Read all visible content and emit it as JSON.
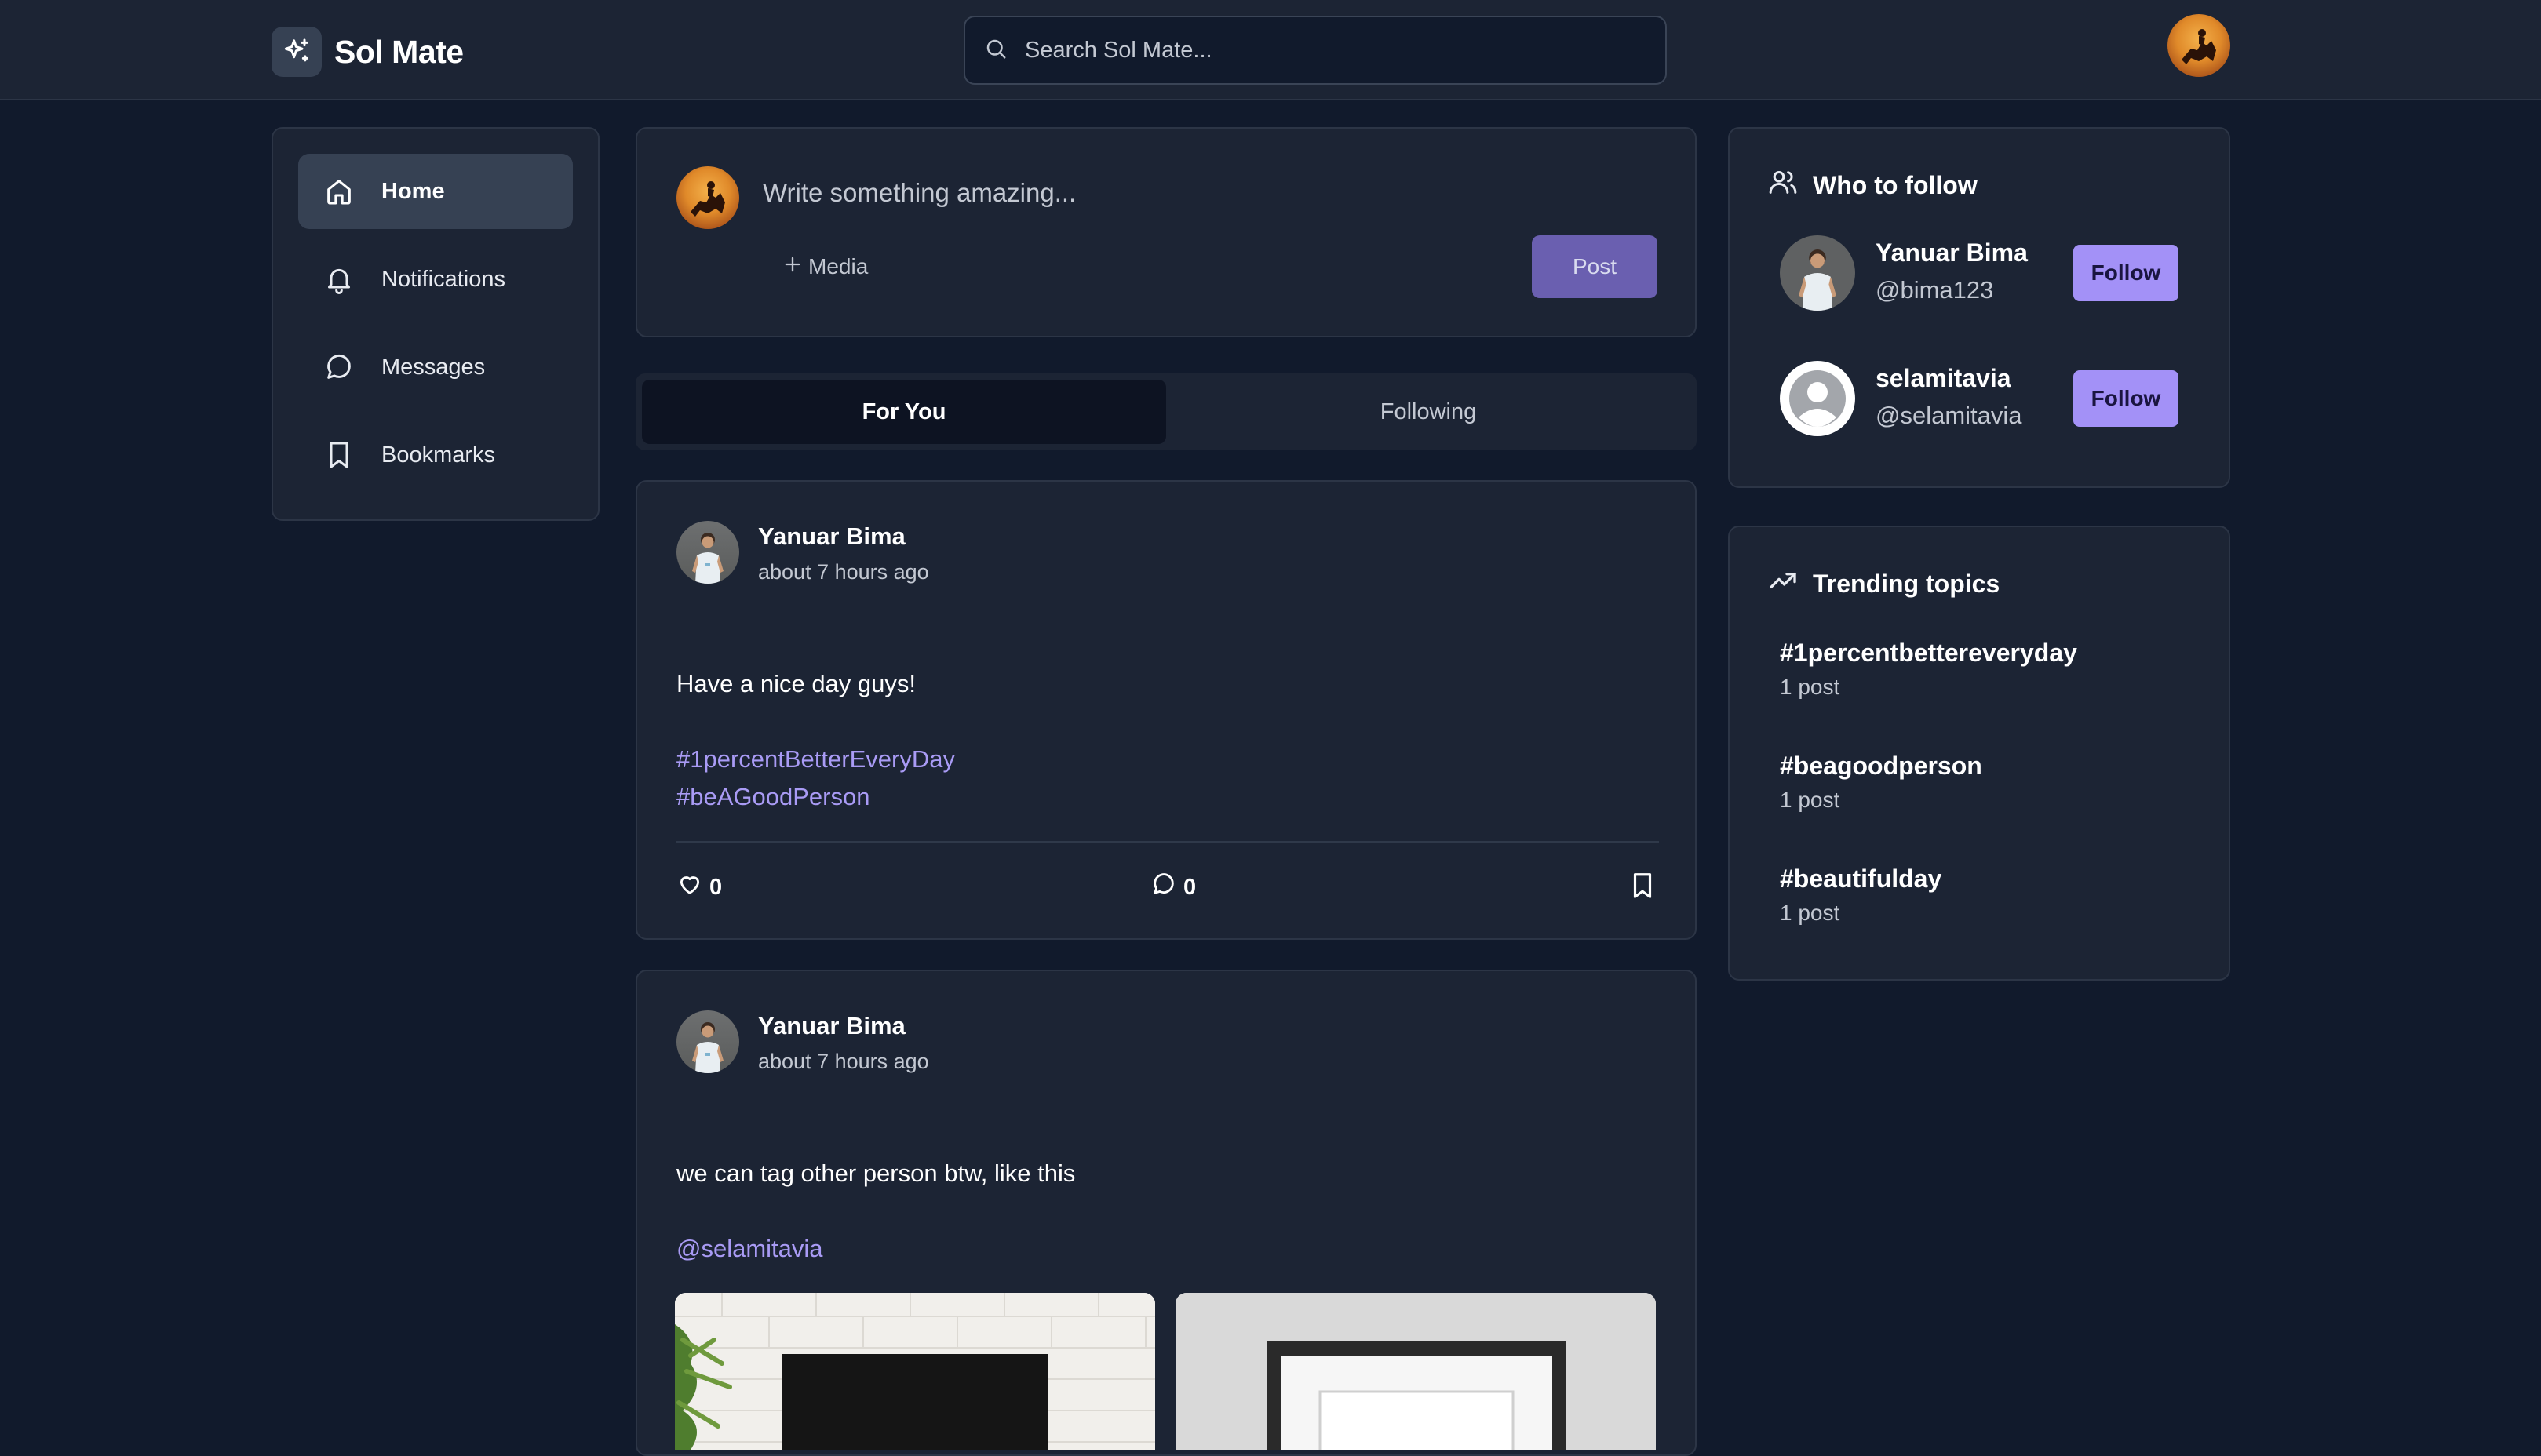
{
  "header": {
    "brand": "Sol Mate",
    "search_placeholder": "Search Sol Mate..."
  },
  "sidebar": {
    "items": [
      {
        "label": "Home",
        "icon": "home-icon",
        "active": true
      },
      {
        "label": "Notifications",
        "icon": "bell-icon",
        "active": false
      },
      {
        "label": "Messages",
        "icon": "message-circle-icon",
        "active": false
      },
      {
        "label": "Bookmarks",
        "icon": "bookmark-icon",
        "active": false
      }
    ]
  },
  "composer": {
    "placeholder": "Write something amazing...",
    "media_label": "Media",
    "post_label": "Post"
  },
  "feed_tabs": [
    {
      "label": "For You",
      "active": true
    },
    {
      "label": "Following",
      "active": false
    }
  ],
  "posts": [
    {
      "author": "Yanuar Bima",
      "time": "about 7 hours ago",
      "text": "Have a nice day guys!",
      "tags": [
        "#1percentBetterEveryDay",
        "#beAGoodPerson"
      ],
      "likes": "0",
      "comments": "0"
    },
    {
      "author": "Yanuar Bima",
      "time": "about 7 hours ago",
      "text": "we can tag other person btw, like this",
      "mention": "@selamitavia"
    }
  ],
  "who_to_follow": {
    "title": "Who to follow",
    "users": [
      {
        "name": "Yanuar Bima",
        "handle": "@bima123",
        "button": "Follow"
      },
      {
        "name": "selamitavia",
        "handle": "@selamitavia",
        "button": "Follow"
      }
    ]
  },
  "trending": {
    "title": "Trending topics",
    "topics": [
      {
        "tag": "#1percentbettereveryday",
        "count": "1 post"
      },
      {
        "tag": "#beagoodperson",
        "count": "1 post"
      },
      {
        "tag": "#beautifulday",
        "count": "1 post"
      }
    ]
  },
  "colors": {
    "background": "#111a2c",
    "surface": "#1c2434",
    "accent": "#a391f7",
    "link": "#a99bf5",
    "post_button": "#6a5fb0"
  }
}
